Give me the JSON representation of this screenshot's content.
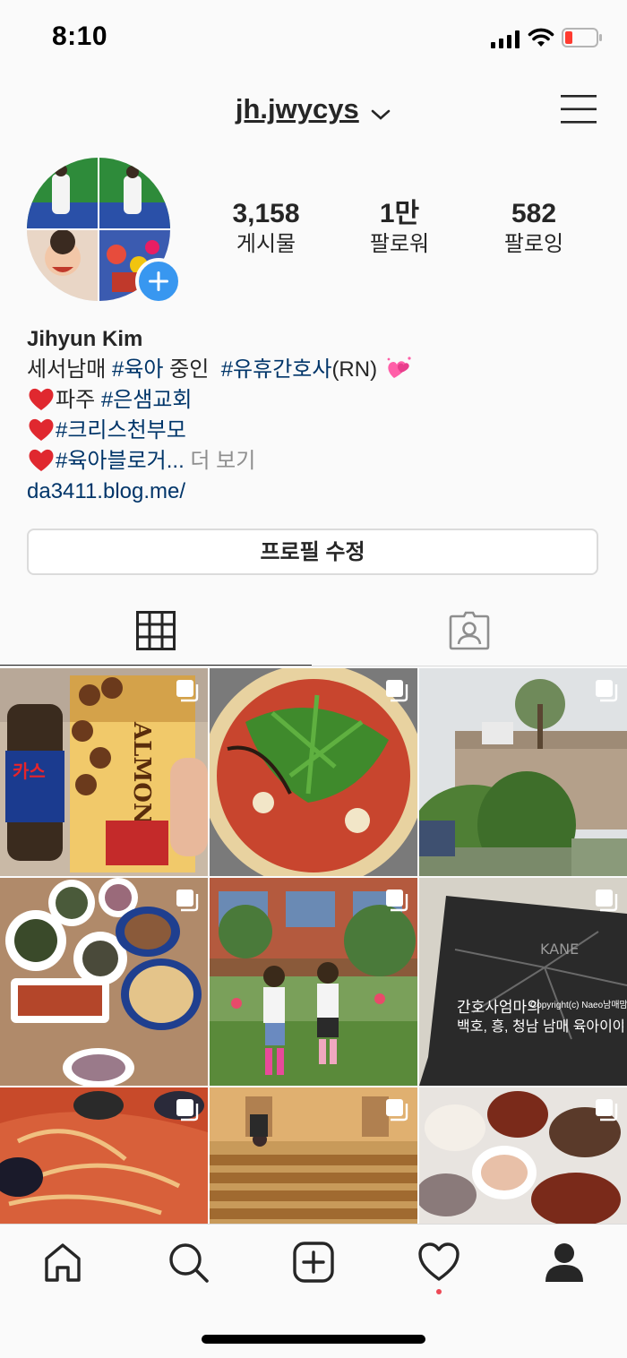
{
  "status_bar": {
    "time": "8:10",
    "battery_color": "#ff3b30"
  },
  "header": {
    "username": "jh.jwycys"
  },
  "profile": {
    "stats": [
      {
        "value": "3,158",
        "label": "게시물"
      },
      {
        "value": "1만",
        "label": "팔로워"
      },
      {
        "value": "582",
        "label": "팔로잉"
      }
    ],
    "name": "Jihyun Kim",
    "bio": {
      "line1": {
        "pre": "세서남매 ",
        "tag1": "#육아",
        "mid": " 중인  ",
        "tag2": "#유휴간호사",
        "post": "(RN)"
      },
      "line2": {
        "pre": "파주 ",
        "tag": "#은샘교회"
      },
      "line3": {
        "tag": "#크리스천부모"
      },
      "line4": {
        "tag": "#육아블로거...",
        "more": " 더 보기"
      }
    },
    "link": "da3411.blog.me/",
    "edit_button": "프로필 수정"
  },
  "posts": [
    {
      "name": "post-drink-almond-chocolate"
    },
    {
      "name": "post-arugula-pizza"
    },
    {
      "name": "post-building-garden"
    },
    {
      "name": "post-korean-dinner-table"
    },
    {
      "name": "post-kids-school-garden"
    },
    {
      "name": "post-dark-sign"
    },
    {
      "name": "post-seafood-pasta"
    },
    {
      "name": "post-church-interior"
    },
    {
      "name": "post-korean-side-dishes"
    }
  ],
  "post_overlay": {
    "small": "Copyright(c) Naeo남매맘",
    "line1": "간호사엄마의",
    "line2": "백호, 흥, 청남 남매 육아이야기♥"
  },
  "colors": {
    "tag": "#003569",
    "accent": "#3897f0",
    "notification": "#ed4956"
  }
}
